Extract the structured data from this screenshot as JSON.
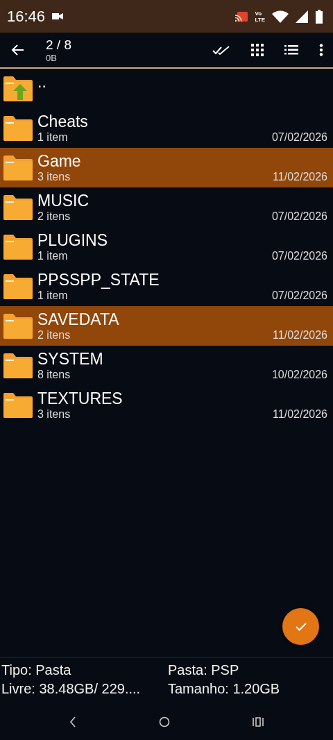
{
  "status_bar": {
    "time": "16:46",
    "volte_top": "Vo",
    "volte_bottom": "LTE"
  },
  "toolbar": {
    "title": "2 / 8",
    "subtitle": "0B"
  },
  "items": [
    {
      "kind": "parent",
      "name": "..",
      "selected": false
    },
    {
      "kind": "folder",
      "name": "Cheats",
      "count": "1 item",
      "date": "07/02/2026",
      "selected": false
    },
    {
      "kind": "folder",
      "name": "Game",
      "count": "3 itens",
      "date": "11/02/2026",
      "selected": true
    },
    {
      "kind": "folder",
      "name": "MUSIC",
      "count": "2 itens",
      "date": "07/02/2026",
      "selected": false
    },
    {
      "kind": "folder",
      "name": "PLUGINS",
      "count": "1 item",
      "date": "07/02/2026",
      "selected": false
    },
    {
      "kind": "folder",
      "name": "PPSSPP_STATE",
      "count": "1 item",
      "date": "07/02/2026",
      "selected": false
    },
    {
      "kind": "folder",
      "name": "SAVEDATA",
      "count": "2 itens",
      "date": "11/02/2026",
      "selected": true
    },
    {
      "kind": "folder",
      "name": "SYSTEM",
      "count": "8 itens",
      "date": "10/02/2026",
      "selected": false
    },
    {
      "kind": "folder",
      "name": "TEXTURES",
      "count": "3 itens",
      "date": "11/02/2026",
      "selected": false
    }
  ],
  "info": [
    "Tipo: Pasta",
    "Pasta: PSP",
    "Livre: 38.48GB/ 229....",
    "Tamanho: 1.20GB"
  ]
}
